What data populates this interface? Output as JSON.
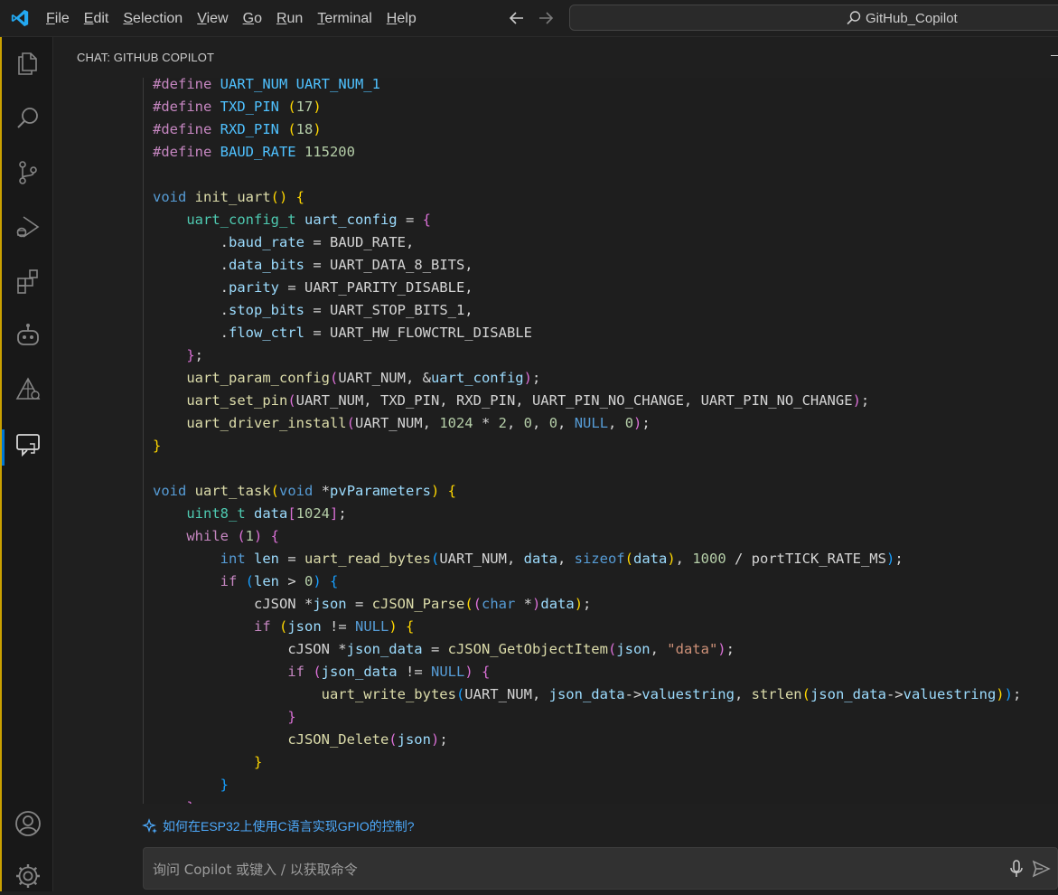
{
  "window": {
    "search_text": "GitHub_Copilot"
  },
  "menu": [
    "File",
    "Edit",
    "Selection",
    "View",
    "Go",
    "Run",
    "Terminal",
    "Help"
  ],
  "activity_bar": [
    "explorer-icon",
    "search-icon",
    "source-control-icon",
    "run-debug-icon",
    "extensions-icon",
    "copilot-icon",
    "remote-icon",
    "chat-icon",
    "account-icon",
    "manage-gear-icon"
  ],
  "chat": {
    "header": "CHAT: GITHUB COPILOT",
    "suggestion": "如何在ESP32上使用C语言实现GPIO的控制?",
    "input_placeholder": "询问 Copilot 或键入 / 以获取命令"
  },
  "code": [
    [
      [
        "pp",
        "#define "
      ],
      [
        "mc",
        "UART_NUM "
      ],
      [
        "mc",
        "UART_NUM_1"
      ]
    ],
    [
      [
        "pp",
        "#define "
      ],
      [
        "mc",
        "TXD_PIN "
      ],
      [
        "b1",
        "("
      ],
      [
        "nu",
        "17"
      ],
      [
        "b1",
        ")"
      ]
    ],
    [
      [
        "pp",
        "#define "
      ],
      [
        "mc",
        "RXD_PIN "
      ],
      [
        "b1",
        "("
      ],
      [
        "nu",
        "18"
      ],
      [
        "b1",
        ")"
      ]
    ],
    [
      [
        "pp",
        "#define "
      ],
      [
        "mc",
        "BAUD_RATE "
      ],
      [
        "nu",
        "115200"
      ]
    ],
    [],
    [
      [
        "kw",
        "void "
      ],
      [
        "fn",
        "init_uart"
      ],
      [
        "b1",
        "() {"
      ]
    ],
    [
      [
        "",
        "    "
      ],
      [
        "ty",
        "uart_config_t "
      ],
      [
        "va",
        "uart_config "
      ],
      [
        "",
        "= "
      ],
      [
        "b2",
        "{"
      ]
    ],
    [
      [
        "",
        "        ."
      ],
      [
        "va",
        "baud_rate "
      ],
      [
        "",
        "= "
      ],
      [
        "",
        "BAUD_RATE,"
      ]
    ],
    [
      [
        "",
        "        ."
      ],
      [
        "va",
        "data_bits "
      ],
      [
        "",
        "= "
      ],
      [
        "",
        "UART_DATA_8_BITS,"
      ]
    ],
    [
      [
        "",
        "        ."
      ],
      [
        "va",
        "parity "
      ],
      [
        "",
        "= "
      ],
      [
        "",
        "UART_PARITY_DISABLE,"
      ]
    ],
    [
      [
        "",
        "        ."
      ],
      [
        "va",
        "stop_bits "
      ],
      [
        "",
        "= "
      ],
      [
        "",
        "UART_STOP_BITS_1,"
      ]
    ],
    [
      [
        "",
        "        ."
      ],
      [
        "va",
        "flow_ctrl "
      ],
      [
        "",
        "= "
      ],
      [
        "",
        "UART_HW_FLOWCTRL_DISABLE"
      ]
    ],
    [
      [
        "",
        "    "
      ],
      [
        "b2",
        "}"
      ],
      [
        "",
        ";"
      ]
    ],
    [
      [
        "",
        "    "
      ],
      [
        "fn",
        "uart_param_config"
      ],
      [
        "b2",
        "("
      ],
      [
        "",
        "UART_NUM, &"
      ],
      [
        "va",
        "uart_config"
      ],
      [
        "b2",
        ")"
      ],
      [
        "",
        ";"
      ]
    ],
    [
      [
        "",
        "    "
      ],
      [
        "fn",
        "uart_set_pin"
      ],
      [
        "b2",
        "("
      ],
      [
        "",
        "UART_NUM, TXD_PIN, RXD_PIN, UART_PIN_NO_CHANGE, UART_PIN_NO_CHANGE"
      ],
      [
        "b2",
        ")"
      ],
      [
        "",
        ";"
      ]
    ],
    [
      [
        "",
        "    "
      ],
      [
        "fn",
        "uart_driver_install"
      ],
      [
        "b2",
        "("
      ],
      [
        "",
        "UART_NUM, "
      ],
      [
        "nu",
        "1024 "
      ],
      [
        "",
        "* "
      ],
      [
        "nu",
        "2"
      ],
      [
        "",
        ", "
      ],
      [
        "nu",
        "0"
      ],
      [
        "",
        ", "
      ],
      [
        "nu",
        "0"
      ],
      [
        "",
        ", "
      ],
      [
        "kw",
        "NULL"
      ],
      [
        "",
        ", "
      ],
      [
        "nu",
        "0"
      ],
      [
        "b2",
        ")"
      ],
      [
        "",
        ";"
      ]
    ],
    [
      [
        "b1",
        "}"
      ]
    ],
    [],
    [
      [
        "kw",
        "void "
      ],
      [
        "fn",
        "uart_task"
      ],
      [
        "b1",
        "("
      ],
      [
        "kw",
        "void "
      ],
      [
        "",
        "*"
      ],
      [
        "va",
        "pvParameters"
      ],
      [
        "b1",
        ") {"
      ]
    ],
    [
      [
        "",
        "    "
      ],
      [
        "ty",
        "uint8_t "
      ],
      [
        "va",
        "data"
      ],
      [
        "b2",
        "["
      ],
      [
        "nu",
        "1024"
      ],
      [
        "b2",
        "]"
      ],
      [
        "",
        ";"
      ]
    ],
    [
      [
        "",
        "    "
      ],
      [
        "ct",
        "while "
      ],
      [
        "b2",
        "("
      ],
      [
        "nu",
        "1"
      ],
      [
        "b2",
        ") {"
      ]
    ],
    [
      [
        "",
        "        "
      ],
      [
        "kw",
        "int "
      ],
      [
        "va",
        "len "
      ],
      [
        "",
        "= "
      ],
      [
        "fn",
        "uart_read_bytes"
      ],
      [
        "b3",
        "("
      ],
      [
        "",
        "UART_NUM, "
      ],
      [
        "va",
        "data"
      ],
      [
        "",
        ", "
      ],
      [
        "kw",
        "sizeof"
      ],
      [
        "b1",
        "("
      ],
      [
        "va",
        "data"
      ],
      [
        "b1",
        ")"
      ],
      [
        "",
        ", "
      ],
      [
        "nu",
        "1000 "
      ],
      [
        "",
        "/ portTICK_RATE_MS"
      ],
      [
        "b3",
        ")"
      ],
      [
        "",
        ";"
      ]
    ],
    [
      [
        "",
        "        "
      ],
      [
        "ct",
        "if "
      ],
      [
        "b3",
        "("
      ],
      [
        "va",
        "len "
      ],
      [
        "",
        "> "
      ],
      [
        "nu",
        "0"
      ],
      [
        "b3",
        ") {"
      ]
    ],
    [
      [
        "",
        "            "
      ],
      [
        "",
        "cJSON *"
      ],
      [
        "va",
        "json "
      ],
      [
        "",
        "= "
      ],
      [
        "fn",
        "cJSON_Parse"
      ],
      [
        "b1",
        "("
      ],
      [
        "b2",
        "("
      ],
      [
        "kw",
        "char "
      ],
      [
        "",
        "*"
      ],
      [
        "b2",
        ")"
      ],
      [
        "va",
        "data"
      ],
      [
        "b1",
        ")"
      ],
      [
        "",
        ";"
      ]
    ],
    [
      [
        "",
        "            "
      ],
      [
        "ct",
        "if "
      ],
      [
        "b1",
        "("
      ],
      [
        "va",
        "json "
      ],
      [
        "",
        "!= "
      ],
      [
        "kw",
        "NULL"
      ],
      [
        "b1",
        ") {"
      ]
    ],
    [
      [
        "",
        "                "
      ],
      [
        "",
        "cJSON *"
      ],
      [
        "va",
        "json_data "
      ],
      [
        "",
        "= "
      ],
      [
        "fn",
        "cJSON_GetObjectItem"
      ],
      [
        "b2",
        "("
      ],
      [
        "va",
        "json"
      ],
      [
        "",
        ", "
      ],
      [
        "st",
        "\"data\""
      ],
      [
        "b2",
        ")"
      ],
      [
        "",
        ";"
      ]
    ],
    [
      [
        "",
        "                "
      ],
      [
        "ct",
        "if "
      ],
      [
        "b2",
        "("
      ],
      [
        "va",
        "json_data "
      ],
      [
        "",
        "!= "
      ],
      [
        "kw",
        "NULL"
      ],
      [
        "b2",
        ") {"
      ]
    ],
    [
      [
        "",
        "                    "
      ],
      [
        "fn",
        "uart_write_bytes"
      ],
      [
        "b3",
        "("
      ],
      [
        "",
        "UART_NUM, "
      ],
      [
        "va",
        "json_data"
      ],
      [
        "",
        "->"
      ],
      [
        "va",
        "valuestring"
      ],
      [
        "",
        ", "
      ],
      [
        "fn",
        "strlen"
      ],
      [
        "b1",
        "("
      ],
      [
        "va",
        "json_data"
      ],
      [
        "",
        "->"
      ],
      [
        "va",
        "valuestring"
      ],
      [
        "b1",
        ")"
      ],
      [
        "b3",
        ")"
      ],
      [
        "",
        ";"
      ]
    ],
    [
      [
        "",
        "                "
      ],
      [
        "b2",
        "}"
      ]
    ],
    [
      [
        "",
        "                "
      ],
      [
        "fn",
        "cJSON_Delete"
      ],
      [
        "b2",
        "("
      ],
      [
        "va",
        "json"
      ],
      [
        "b2",
        ")"
      ],
      [
        "",
        ";"
      ]
    ],
    [
      [
        "",
        "            "
      ],
      [
        "b1",
        "}"
      ]
    ],
    [
      [
        "",
        "        "
      ],
      [
        "b3",
        "}"
      ]
    ],
    [
      [
        "",
        "    "
      ],
      [
        "b2",
        "}"
      ]
    ]
  ]
}
